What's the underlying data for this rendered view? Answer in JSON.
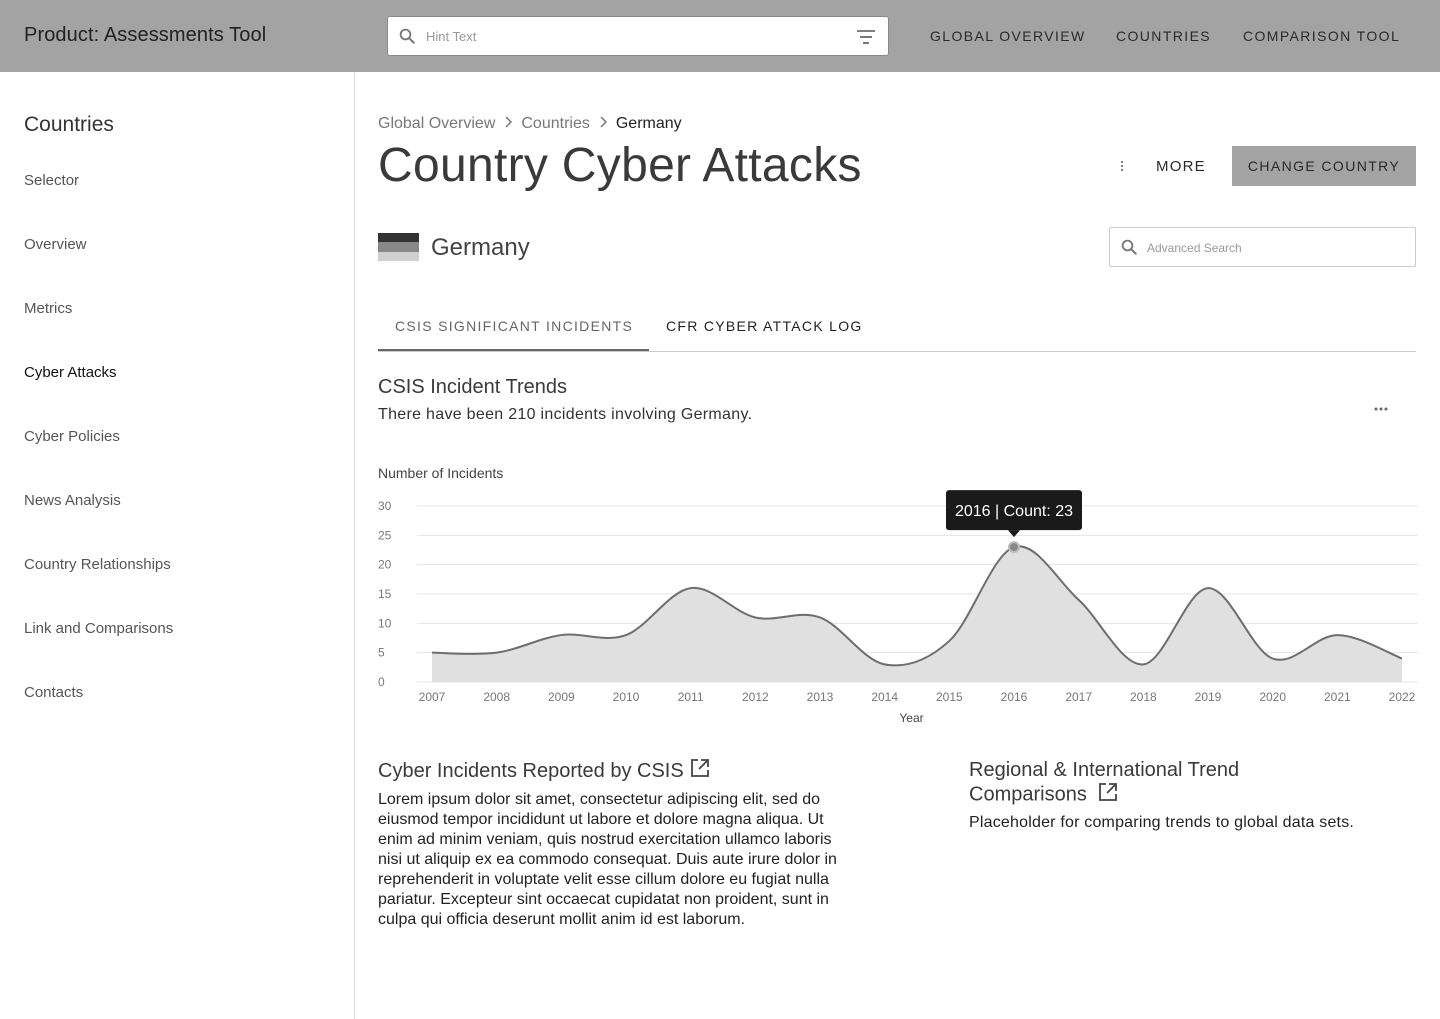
{
  "app": {
    "title": "Product: Assessments Tool"
  },
  "search": {
    "placeholder": "Hint Text"
  },
  "nav": [
    "GLOBAL OVERVIEW",
    "COUNTRIES",
    "COMPARISON TOOL"
  ],
  "sidebar": {
    "title": "Countries",
    "items": [
      {
        "label": "Selector"
      },
      {
        "label": "Overview"
      },
      {
        "label": "Metrics"
      },
      {
        "label": "Cyber Attacks",
        "active": true
      },
      {
        "label": "Cyber Policies"
      },
      {
        "label": "News Analysis"
      },
      {
        "label": "Country Relationships"
      },
      {
        "label": "Link and Comparisons"
      },
      {
        "label": "Contacts"
      }
    ]
  },
  "breadcrumb": [
    "Global Overview",
    "Countries",
    "Germany"
  ],
  "page": {
    "title": "Country Cyber Attacks",
    "more_label": "MORE",
    "change_label": "CHANGE COUNTRY",
    "country": "Germany",
    "adv_search_placeholder": "Advanced Search"
  },
  "tabs": [
    "CSIS SIGNIFICANT INCIDENTS",
    "CFR CYBER ATTACK LOG"
  ],
  "trends": {
    "title": "CSIS Incident Trends",
    "subtitle": "There have been 210 incidents involving Germany."
  },
  "chart_data": {
    "type": "area",
    "ylabel": "Number of Incidents",
    "xlabel": "Year",
    "ylim": [
      0,
      30
    ],
    "yticks": [
      0,
      5,
      10,
      15,
      20,
      25,
      30
    ],
    "x": [
      2007,
      2008,
      2009,
      2010,
      2011,
      2012,
      2013,
      2014,
      2015,
      2016,
      2017,
      2018,
      2019,
      2020,
      2021,
      2022
    ],
    "series": [
      {
        "values": [
          5,
          5,
          8,
          8,
          16,
          11,
          11,
          3,
          7,
          23,
          14,
          3,
          16,
          4,
          8,
          4
        ]
      }
    ],
    "tooltip": "2016 | Count: 23",
    "grid": true
  },
  "csis_section": {
    "title": "Cyber Incidents Reported by CSIS",
    "body": "Lorem ipsum dolor sit amet, consectetur adipiscing elit, sed do eiusmod tempor incididunt ut labore et dolore magna aliqua. Ut enim ad minim veniam, quis nostrud exercitation ullamco laboris nisi ut aliquip ex ea commodo consequat. Duis aute irure dolor in reprehenderit in voluptate velit esse cillum dolore eu fugiat nulla pariatur. Excepteur sint occaecat cupidatat non proident, sunt in culpa qui officia deserunt mollit anim id est laborum."
  },
  "regional_section": {
    "title": "Regional & International Trend Comparisons",
    "body": "Placeholder for comparing trends to global data sets."
  },
  "colors": {
    "topbar": "#a3a3a3",
    "area_fill": "#e0e0e0",
    "line": "#6e6e6e",
    "tooltip_bg": "#1a1a1a"
  },
  "icons": {
    "search": "search-icon",
    "filter": "filter-icon",
    "external": "external-link-icon"
  }
}
